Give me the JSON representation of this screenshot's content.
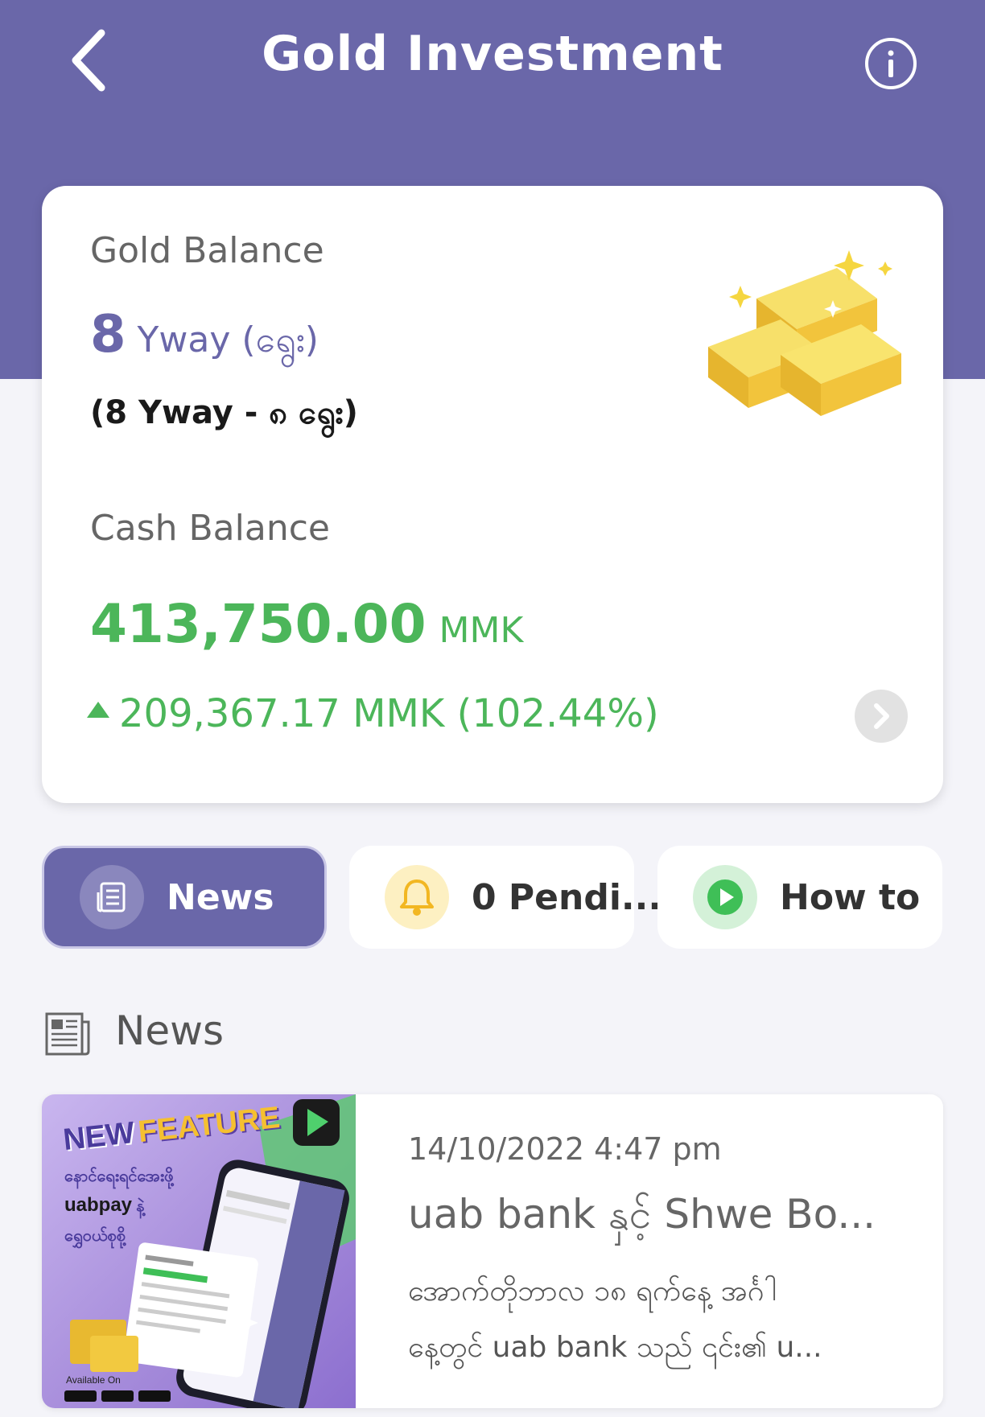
{
  "header": {
    "title": "Gold Investment",
    "back_icon": "chevron-left-icon",
    "info_icon": "info-icon"
  },
  "balance": {
    "gold_label": "Gold Balance",
    "gold_value": "8",
    "gold_unit": "Yway (ရွေး)",
    "gold_detail": "(8 Yway - ၈ ရွေး)",
    "cash_label": "Cash Balance",
    "cash_value": "413,750.00",
    "cash_unit": "MMK",
    "gain_text": "209,367.17 MMK (102.44%)",
    "gold_image_icon": "gold-bars-icon"
  },
  "actions": [
    {
      "label": "News",
      "icon": "news-icon",
      "active": true
    },
    {
      "label": "0 Pendi...",
      "icon": "bell-icon",
      "active": false
    },
    {
      "label": "How to",
      "icon": "play-icon",
      "active": false
    }
  ],
  "news": {
    "heading": "News",
    "heading_icon": "newspaper-icon",
    "items": [
      {
        "date": "14/10/2022 4:47 pm",
        "title": "uab bank နှင့် Shwe Bo...",
        "excerpt_line1": "အောက်တိုဘာလ ၁၈ ရက်နေ့ အင်္ဂါ",
        "excerpt_line2": "နေ့တွင် uab bank သည် ၎င်း၏ u...",
        "thumb": {
          "headline_1": "NEW",
          "headline_2": "FEATURE",
          "line1": "နောင်ရေးရင်အေးဖို့",
          "brand": "uabpay",
          "brand_suffix": "နဲ့",
          "line3": "ရွှေဝယ်စုစို့",
          "available": "Available On"
        }
      }
    ]
  },
  "colors": {
    "brand": "#6a67a9",
    "positive": "#4cb65a",
    "gold": "#f2c43c"
  }
}
